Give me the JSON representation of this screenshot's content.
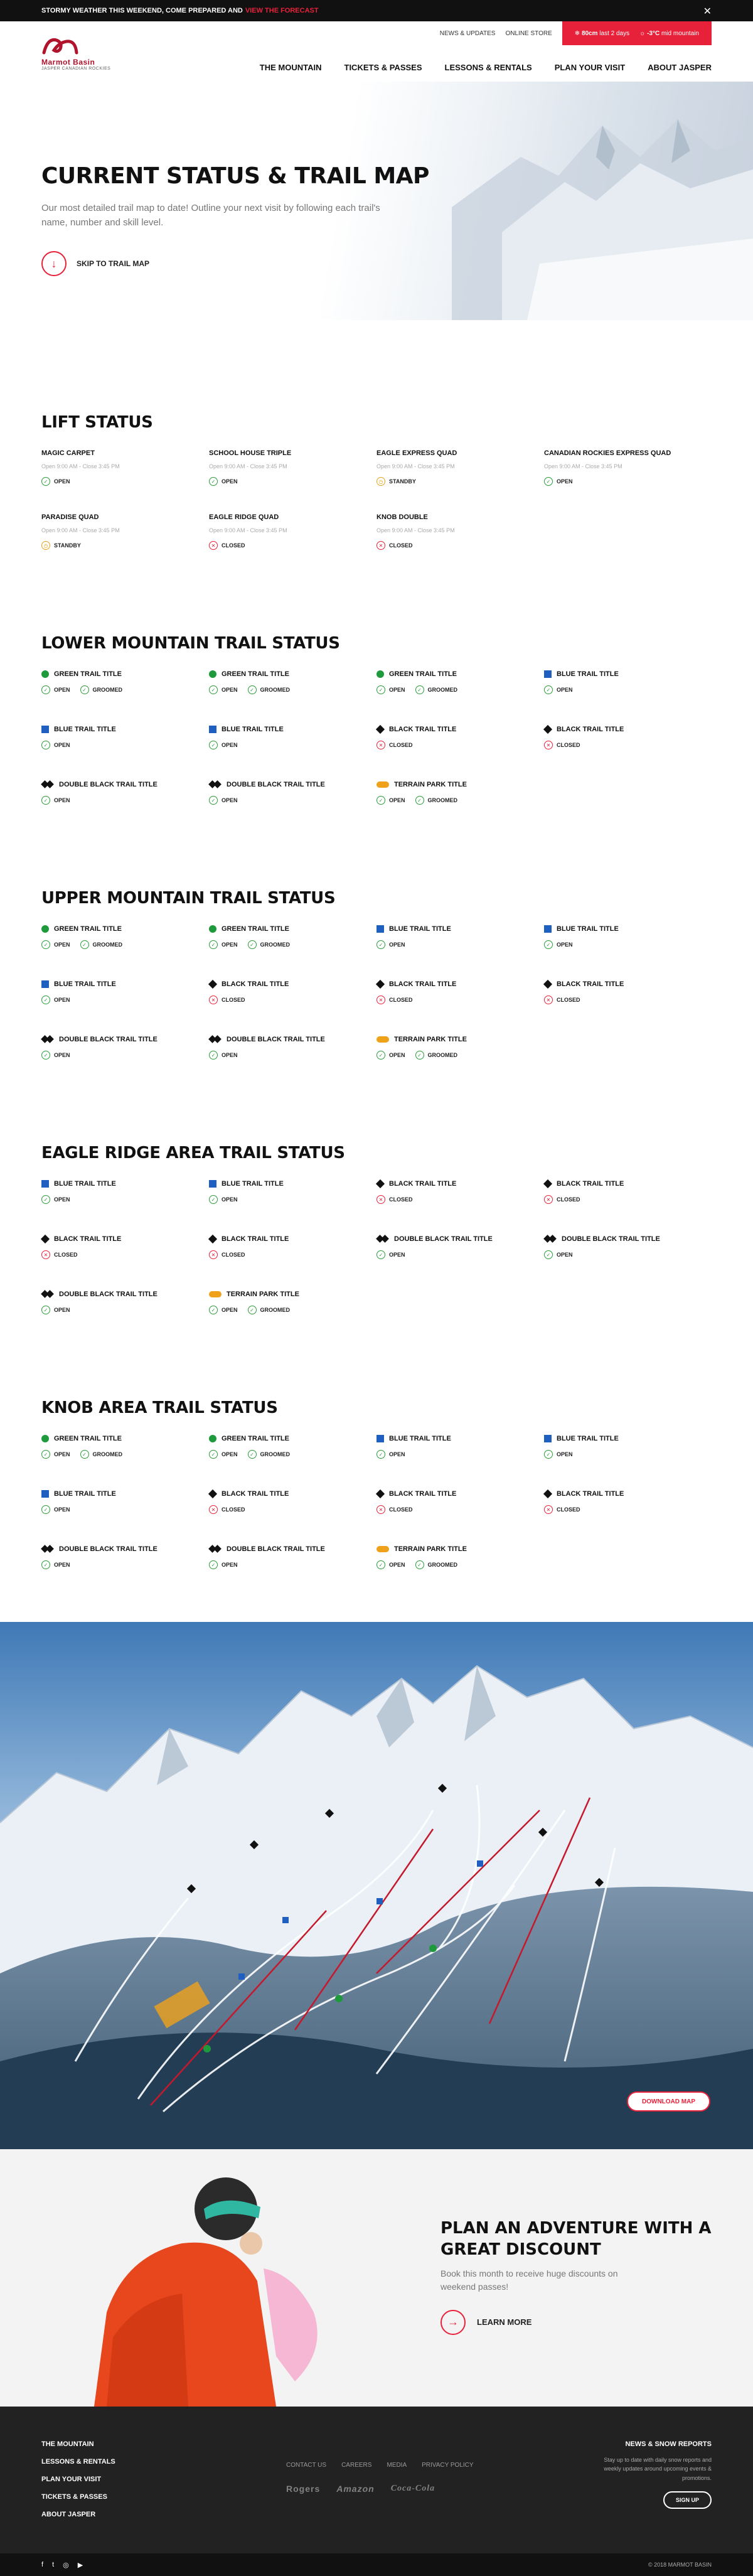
{
  "alert": {
    "text": "Stormy weather this weekend, come prepared and",
    "link": "View the forecast"
  },
  "brand": {
    "name": "Marmot Basin",
    "tagline": "Jasper Canadian Rockies"
  },
  "util_nav": {
    "news": "News & Updates",
    "store": "Online Store",
    "snow_value": "80cm",
    "snow_label": "last 2 days",
    "temp_value": "-3°C",
    "temp_label": "mid mountain"
  },
  "main_nav": [
    "The Mountain",
    "Tickets & Passes",
    "Lessons & Rentals",
    "Plan Your Visit",
    "About Jasper"
  ],
  "hero": {
    "title": "Current Status & Trail Map",
    "desc": "Our most detailed trail map to date! Outline your next visit by following each trail's name, number and skill level.",
    "skip": "Skip to trail map"
  },
  "lift_status": {
    "title": "Lift Status",
    "items": [
      {
        "name": "Magic Carpet",
        "hours": "Open 9:00 AM - Close 3:45 PM",
        "status": "open",
        "status_label": "Open"
      },
      {
        "name": "School House Triple",
        "hours": "Open 9:00 AM - Close 3:45 PM",
        "status": "open",
        "status_label": "Open"
      },
      {
        "name": "Eagle Express Quad",
        "hours": "Open 9:00 AM - Close 3:45 PM",
        "status": "standby",
        "status_label": "Standby"
      },
      {
        "name": "Canadian Rockies Express Quad",
        "hours": "Open 9:00 AM - Close 3:45 PM",
        "status": "open",
        "status_label": "Open"
      },
      {
        "name": "Paradise Quad",
        "hours": "Open 9:00 AM - Close 3:45 PM",
        "status": "standby",
        "status_label": "Standby"
      },
      {
        "name": "Eagle Ridge Quad",
        "hours": "Open 9:00 AM - Close 3:45 PM",
        "status": "closed",
        "status_label": "Closed"
      },
      {
        "name": "Knob Double",
        "hours": "Open 9:00 AM - Close 3:45 PM",
        "status": "closed",
        "status_label": "Closed"
      }
    ]
  },
  "labels": {
    "open": "Open",
    "closed": "Closed",
    "groomed": "Groomed"
  },
  "trail_sections": [
    {
      "title": "Lower Mountain Trail Status",
      "items": [
        {
          "name": "Green Trail Title",
          "diff": "green",
          "status": "open",
          "groomed": true
        },
        {
          "name": "Green Trail Title",
          "diff": "green",
          "status": "open",
          "groomed": true
        },
        {
          "name": "Green Trail Title",
          "diff": "green",
          "status": "open",
          "groomed": true
        },
        {
          "name": "Blue Trail Title",
          "diff": "blue",
          "status": "open",
          "groomed": false
        },
        {
          "name": "Blue Trail Title",
          "diff": "blue",
          "status": "open",
          "groomed": false
        },
        {
          "name": "Blue Trail Title",
          "diff": "blue",
          "status": "open",
          "groomed": false
        },
        {
          "name": "Black Trail Title",
          "diff": "black",
          "status": "closed",
          "groomed": false
        },
        {
          "name": "Black Trail Title",
          "diff": "black",
          "status": "closed",
          "groomed": false
        },
        {
          "name": "Double Black Trail Title",
          "diff": "dblack",
          "status": "open",
          "groomed": false
        },
        {
          "name": "Double Black Trail Title",
          "diff": "dblack",
          "status": "open",
          "groomed": false
        },
        {
          "name": "Terrain Park Title",
          "diff": "park",
          "status": "open",
          "groomed": true
        }
      ]
    },
    {
      "title": "Upper Mountain Trail Status",
      "items": [
        {
          "name": "Green Trail Title",
          "diff": "green",
          "status": "open",
          "groomed": true
        },
        {
          "name": "Green Trail Title",
          "diff": "green",
          "status": "open",
          "groomed": true
        },
        {
          "name": "Blue Trail Title",
          "diff": "blue",
          "status": "open",
          "groomed": false
        },
        {
          "name": "Blue Trail Title",
          "diff": "blue",
          "status": "open",
          "groomed": false
        },
        {
          "name": "Blue Trail Title",
          "diff": "blue",
          "status": "open",
          "groomed": false
        },
        {
          "name": "Black Trail Title",
          "diff": "black",
          "status": "closed",
          "groomed": false
        },
        {
          "name": "Black Trail Title",
          "diff": "black",
          "status": "closed",
          "groomed": false
        },
        {
          "name": "Black Trail Title",
          "diff": "black",
          "status": "closed",
          "groomed": false
        },
        {
          "name": "Double Black Trail Title",
          "diff": "dblack",
          "status": "open",
          "groomed": false
        },
        {
          "name": "Double Black Trail Title",
          "diff": "dblack",
          "status": "open",
          "groomed": false
        },
        {
          "name": "Terrain Park Title",
          "diff": "park",
          "status": "open",
          "groomed": true
        }
      ]
    },
    {
      "title": "Eagle Ridge Area Trail Status",
      "items": [
        {
          "name": "Blue Trail Title",
          "diff": "blue",
          "status": "open",
          "groomed": false
        },
        {
          "name": "Blue Trail Title",
          "diff": "blue",
          "status": "open",
          "groomed": false
        },
        {
          "name": "Black Trail Title",
          "diff": "black",
          "status": "closed",
          "groomed": false
        },
        {
          "name": "Black Trail Title",
          "diff": "black",
          "status": "closed",
          "groomed": false
        },
        {
          "name": "Black Trail Title",
          "diff": "black",
          "status": "closed",
          "groomed": false
        },
        {
          "name": "Black Trail Title",
          "diff": "black",
          "status": "closed",
          "groomed": false
        },
        {
          "name": "Double Black Trail Title",
          "diff": "dblack",
          "status": "open",
          "groomed": false
        },
        {
          "name": "Double Black Trail Title",
          "diff": "dblack",
          "status": "open",
          "groomed": false
        },
        {
          "name": "Double Black Trail Title",
          "diff": "dblack",
          "status": "open",
          "groomed": false
        },
        {
          "name": "Terrain Park Title",
          "diff": "park",
          "status": "open",
          "groomed": true
        }
      ]
    },
    {
      "title": "Knob Area Trail Status",
      "items": [
        {
          "name": "Green Trail Title",
          "diff": "green",
          "status": "open",
          "groomed": true
        },
        {
          "name": "Green Trail Title",
          "diff": "green",
          "status": "open",
          "groomed": true
        },
        {
          "name": "Blue Trail Title",
          "diff": "blue",
          "status": "open",
          "groomed": false
        },
        {
          "name": "Blue Trail Title",
          "diff": "blue",
          "status": "open",
          "groomed": false
        },
        {
          "name": "Blue Trail Title",
          "diff": "blue",
          "status": "open",
          "groomed": false
        },
        {
          "name": "Black Trail Title",
          "diff": "black",
          "status": "closed",
          "groomed": false
        },
        {
          "name": "Black Trail Title",
          "diff": "black",
          "status": "closed",
          "groomed": false
        },
        {
          "name": "Black Trail Title",
          "diff": "black",
          "status": "closed",
          "groomed": false
        },
        {
          "name": "Double Black Trail Title",
          "diff": "dblack",
          "status": "open",
          "groomed": false
        },
        {
          "name": "Double Black Trail Title",
          "diff": "dblack",
          "status": "open",
          "groomed": false
        },
        {
          "name": "Terrain Park Title",
          "diff": "park",
          "status": "open",
          "groomed": true
        }
      ]
    }
  ],
  "trail_map": {
    "download": "Download Map"
  },
  "promo": {
    "title": "Plan an adventure with a great discount",
    "desc": "Book this month to receive huge discounts on weekend passes!",
    "cta": "Learn More"
  },
  "footer": {
    "links": [
      "The Mountain",
      "Lessons & Rentals",
      "Plan Your Visit",
      "Tickets & Passes",
      "About Jasper"
    ],
    "center_links": [
      "Contact Us",
      "Careers",
      "Media",
      "Privacy Policy"
    ],
    "sponsors": [
      "Rogers",
      "Amazon",
      "Coca-Cola"
    ],
    "news_title": "News & Snow Reports",
    "news_desc": "Stay up to date with daily snow reports and weekly updates around upcoming events & promotions.",
    "signup": "Sign Up",
    "copyright": "© 2018 Marmot Basin"
  },
  "colors": {
    "accent": "#e8213a",
    "open": "#2a9d3a",
    "closed": "#e8213a",
    "standby": "#e8a21a",
    "green_trail": "#1e9a3c",
    "blue_trail": "#1f5fbf",
    "park": "#f0a11a"
  }
}
